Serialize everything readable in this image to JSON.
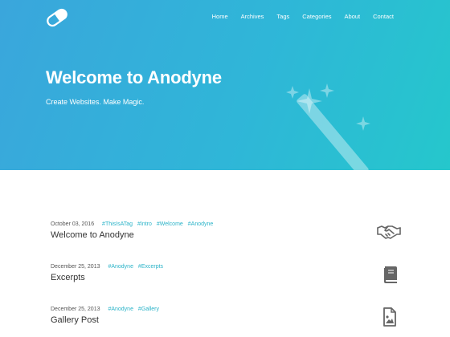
{
  "brand": {
    "logo_icon": "pill-icon"
  },
  "nav": {
    "items": [
      "Home",
      "Archives",
      "Tags",
      "Categories",
      "About",
      "Contact"
    ]
  },
  "hero": {
    "title": "Welcome to Anodyne",
    "subtitle": "Create Websites. Make Magic.",
    "illustration_icon": "magic-wand-icon",
    "gradient_start": "#3aa6dc",
    "gradient_end": "#25c7cc"
  },
  "accent_color": "#2ab3c8",
  "posts": [
    {
      "date": "October 03, 2016",
      "tags": [
        "#ThisIsATag",
        "#Intro",
        "#Welcome",
        "#Anodyne"
      ],
      "title": "Welcome to Anodyne",
      "icon": "handshake-icon"
    },
    {
      "date": "December 25, 2013",
      "tags": [
        "#Anodyne",
        "#Excerpts"
      ],
      "title": "Excerpts",
      "icon": "book-icon"
    },
    {
      "date": "December 25, 2013",
      "tags": [
        "#Anodyne",
        "#Gallery"
      ],
      "title": "Gallery Post",
      "icon": "image-file-icon"
    }
  ]
}
